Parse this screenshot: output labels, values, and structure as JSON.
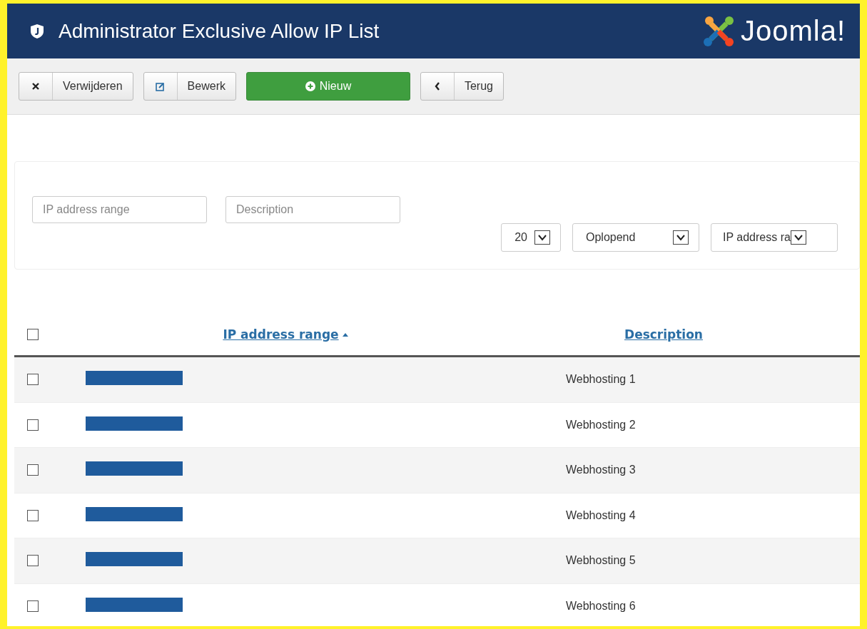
{
  "header": {
    "title": "Administrator Exclusive Allow IP List",
    "logo_text": "Joomla!"
  },
  "toolbar": [
    {
      "kind": "delete",
      "label": "Verwijderen"
    },
    {
      "kind": "edit",
      "label": "Bewerk"
    },
    {
      "kind": "new",
      "label": "Nieuw"
    },
    {
      "kind": "back",
      "label": "Terug"
    }
  ],
  "filters": {
    "fields": [
      {
        "placeholder": "IP address range"
      },
      {
        "placeholder": "Description"
      }
    ],
    "selects": [
      {
        "value": "20"
      },
      {
        "value": "Oplopend"
      },
      {
        "value": "IP address ra"
      }
    ]
  },
  "table": {
    "select_all": {
      "checked": false
    },
    "columns": [
      {
        "label": "IP address range",
        "sorted": true
      },
      {
        "label": "Description",
        "sorted": false
      }
    ],
    "rows": [
      {
        "checked": false,
        "description": "Webhosting 1"
      },
      {
        "checked": false,
        "description": "Webhosting 2"
      },
      {
        "checked": false,
        "description": "Webhosting 3"
      },
      {
        "checked": false,
        "description": "Webhosting 4"
      },
      {
        "checked": false,
        "description": "Webhosting 5"
      },
      {
        "checked": false,
        "description": "Webhosting 6"
      }
    ]
  }
}
